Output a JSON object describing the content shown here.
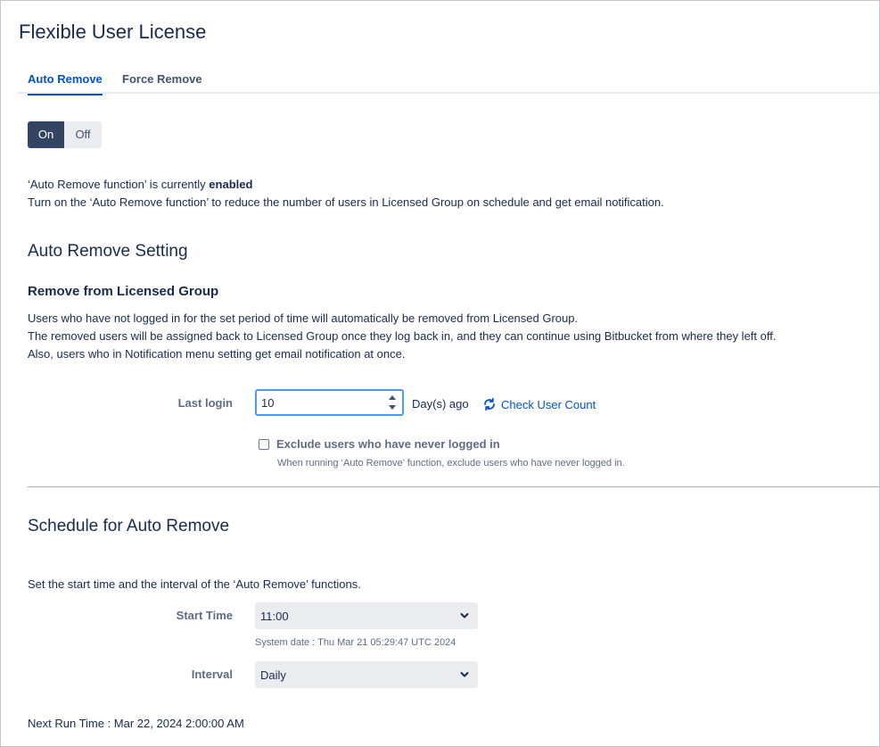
{
  "page": {
    "title": "Flexible User License"
  },
  "tabs": [
    {
      "label": "Auto Remove",
      "active": true
    },
    {
      "label": "Force Remove",
      "active": false
    }
  ],
  "toggle": {
    "on_label": "On",
    "off_label": "Off",
    "selected": "On"
  },
  "status": {
    "prefix": "‘Auto Remove function’ is currently",
    "state": "enabled",
    "description": "Turn on the ‘Auto Remove function’ to reduce the number of users in Licensed Group on schedule and get email notification."
  },
  "auto_remove_setting": {
    "heading": "Auto Remove Setting",
    "subheading": "Remove from Licensed Group",
    "lines": [
      "Users who have not logged in for the set period of time will automatically be removed from Licensed Group.",
      "The removed users will be assigned back to Licensed Group once they log back in, and they can continue using Bitbucket from where they left off.",
      "Also, users who in Notification menu setting get email notification at once."
    ],
    "last_login_label": "Last login",
    "last_login_value": "10",
    "unit": "Day(s) ago",
    "check_user_count": "Check User Count",
    "exclude_label": "Exclude users who have never logged in",
    "exclude_checked": false,
    "exclude_help": "When running ‘Auto Remove’ function, exclude users who have never logged in."
  },
  "schedule": {
    "heading": "Schedule for Auto Remove",
    "description": "Set the start time and the interval of the ‘Auto Remove’ functions.",
    "start_time_label": "Start Time",
    "start_time_value": "11:00",
    "system_date": "System date : Thu Mar 21 05:29:47 UTC 2024",
    "interval_label": "Interval",
    "interval_value": "Daily",
    "next_run": "Next Run Time : Mar 22, 2024 2:00:00 AM"
  },
  "colors": {
    "accent": "#0052cc",
    "toggle_on_bg": "#344563",
    "focus_border": "#4c9aff"
  },
  "icons": [
    "refresh-icon",
    "chevron-down-icon",
    "spinner-icon",
    "checkbox-icon"
  ]
}
